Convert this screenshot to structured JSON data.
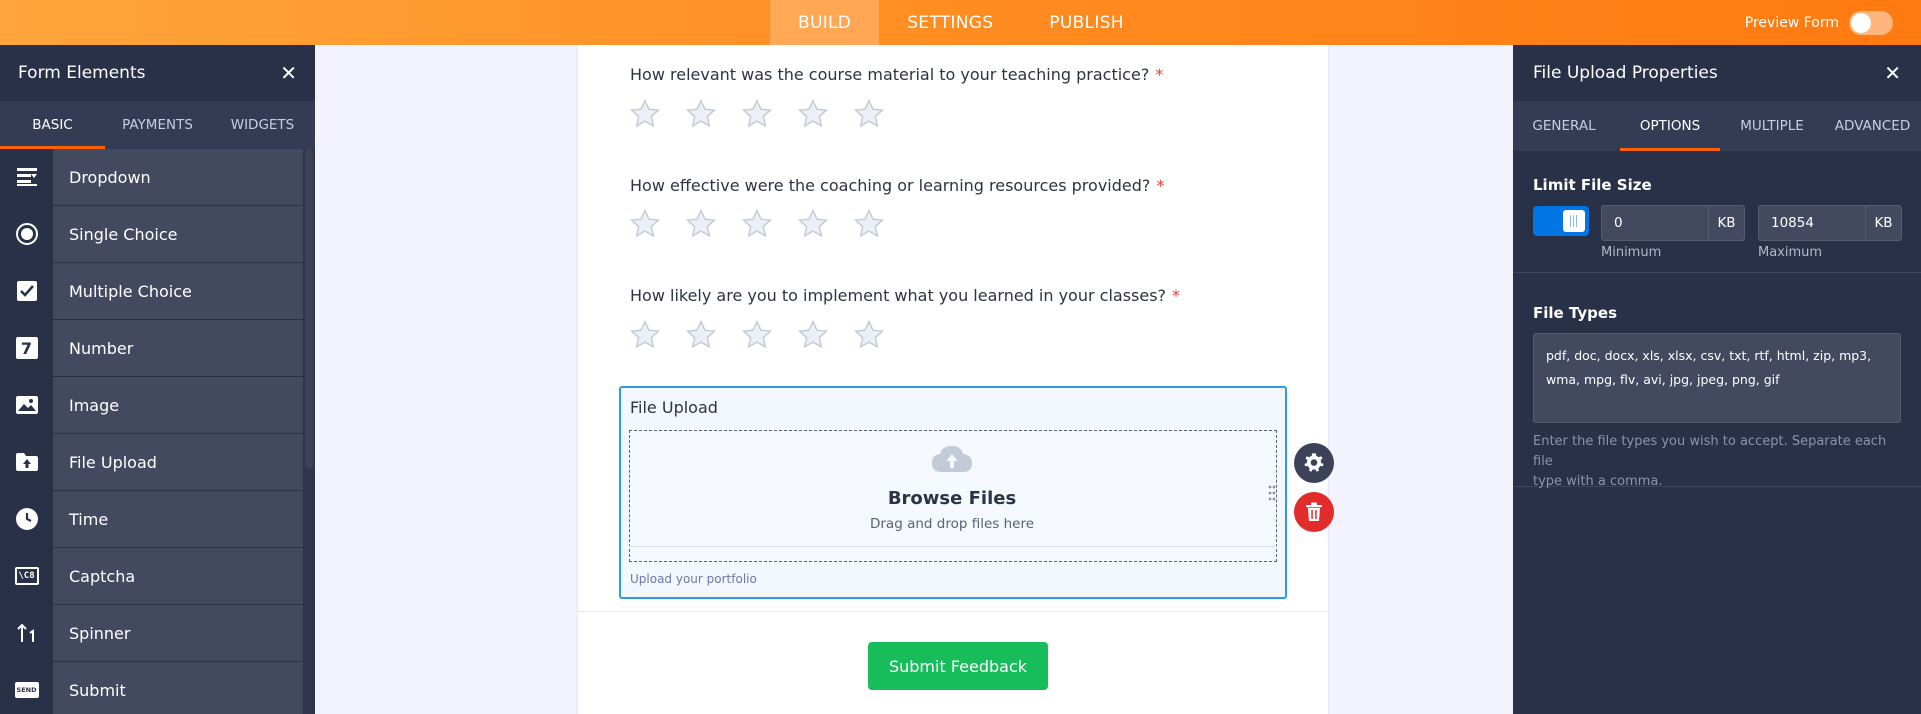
{
  "topbar": {
    "tabs": [
      {
        "label": "BUILD",
        "active": true
      },
      {
        "label": "SETTINGS",
        "active": false
      },
      {
        "label": "PUBLISH",
        "active": false
      }
    ],
    "preview_label": "Preview Form",
    "preview_on": false
  },
  "left_panel": {
    "title": "Form Elements",
    "tabs": [
      {
        "label": "BASIC",
        "active": true
      },
      {
        "label": "PAYMENTS",
        "active": false
      },
      {
        "label": "WIDGETS",
        "active": false
      }
    ],
    "items": [
      {
        "label": "Dropdown",
        "icon": "dropdown-icon"
      },
      {
        "label": "Single Choice",
        "icon": "radio-icon"
      },
      {
        "label": "Multiple Choice",
        "icon": "checkbox-icon"
      },
      {
        "label": "Number",
        "icon": "number-icon"
      },
      {
        "label": "Image",
        "icon": "image-icon"
      },
      {
        "label": "File Upload",
        "icon": "file-upload-icon"
      },
      {
        "label": "Time",
        "icon": "clock-icon"
      },
      {
        "label": "Captcha",
        "icon": "captcha-icon"
      },
      {
        "label": "Spinner",
        "icon": "spinner-icon"
      },
      {
        "label": "Submit",
        "icon": "send-icon"
      }
    ],
    "number_icon_glyph": "7",
    "captcha_icon_glyph": "\\C8",
    "send_icon_glyph": "SEND"
  },
  "form": {
    "questions": [
      {
        "label": "How relevant was the course material to your teaching practice?",
        "required_mark": "*",
        "stars": 5
      },
      {
        "label": "How effective were the coaching or learning resources provided?",
        "required_mark": "*",
        "stars": 5
      },
      {
        "label": "How likely are you to implement what you learned in your classes?",
        "required_mark": "*",
        "stars": 5
      }
    ],
    "file_upload": {
      "label": "File Upload",
      "browse_title": "Browse Files",
      "browse_subtitle": "Drag and drop files here",
      "sublabel": "Upload your portfolio"
    },
    "submit_label": "Submit Feedback"
  },
  "right_panel": {
    "title": "File Upload Properties",
    "tabs": [
      {
        "label": "GENERAL",
        "active": false
      },
      {
        "label": "OPTIONS",
        "active": true
      },
      {
        "label": "MULTIPLE",
        "active": false
      },
      {
        "label": "ADVANCED",
        "active": false
      }
    ],
    "limit_file_size": {
      "title": "Limit File Size",
      "enabled": true,
      "minimum": {
        "value": "0",
        "unit": "KB",
        "caption": "Minimum"
      },
      "maximum": {
        "value": "10854",
        "unit": "KB",
        "caption": "Maximum"
      }
    },
    "file_types": {
      "title": "File Types",
      "value_line1": "pdf, doc, docx, xls, xlsx, csv, txt, rtf, html, zip, mp3,",
      "value_line2": "wma, mpg, flv, avi, jpg, jpeg, png, gif",
      "help_line1": "Enter the file types you wish to accept. Separate each file",
      "help_line2": "type with a comma."
    }
  },
  "colors": {
    "topbar_orange": "#ff8a1f",
    "panel_dark": "#293149",
    "accent_tab": "#ff6100",
    "selected_border": "#2d9ce4",
    "submit_green": "#18bd5b",
    "delete_red": "#e22c2c",
    "required_red": "#f23a3c",
    "toggle_blue": "#0075e3"
  }
}
